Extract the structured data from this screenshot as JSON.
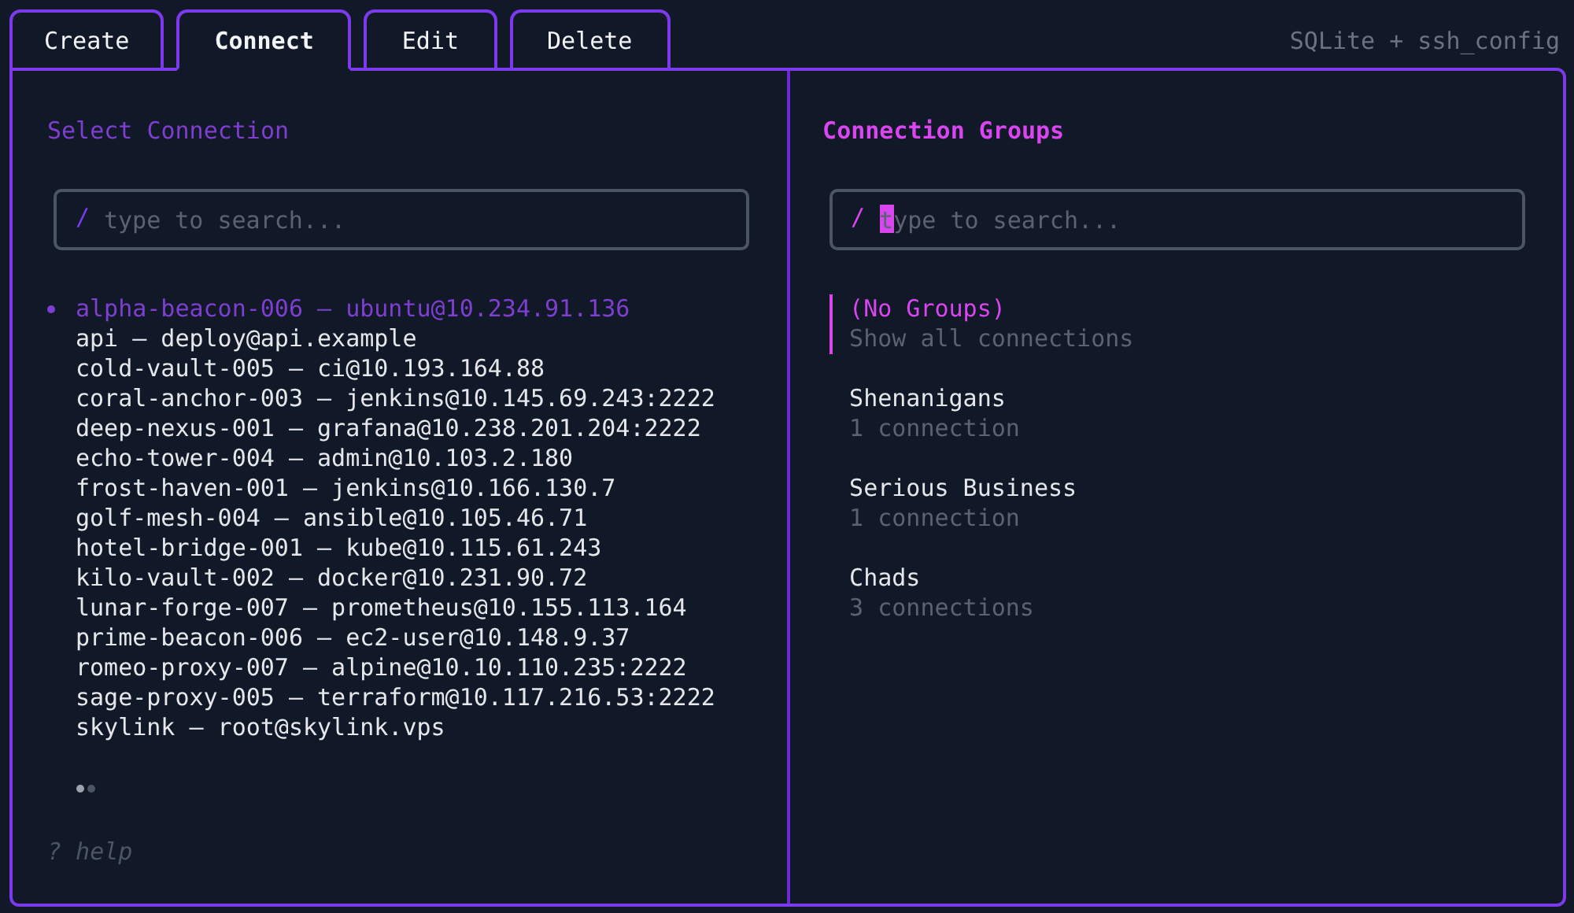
{
  "tabs": [
    {
      "label": "Create",
      "selected": false
    },
    {
      "label": "Connect",
      "selected": true
    },
    {
      "label": "Edit",
      "selected": false
    },
    {
      "label": "Delete",
      "selected": false
    }
  ],
  "source_label": "SQLite + ssh_config",
  "connections_panel": {
    "title": "Select Connection",
    "search": {
      "prefix": "/",
      "placeholder": "type to search...",
      "focused": false
    },
    "items": [
      {
        "name": "alpha-beacon-006",
        "separator": "–",
        "target": "ubuntu@10.234.91.136",
        "selected": true
      },
      {
        "name": "api",
        "separator": "–",
        "target": "deploy@api.example",
        "selected": false
      },
      {
        "name": "cold-vault-005",
        "separator": "–",
        "target": "ci@10.193.164.88",
        "selected": false
      },
      {
        "name": "coral-anchor-003",
        "separator": "–",
        "target": "jenkins@10.145.69.243:2222",
        "selected": false
      },
      {
        "name": "deep-nexus-001",
        "separator": "–",
        "target": "grafana@10.238.201.204:2222",
        "selected": false
      },
      {
        "name": "echo-tower-004",
        "separator": "–",
        "target": "admin@10.103.2.180",
        "selected": false
      },
      {
        "name": "frost-haven-001",
        "separator": "–",
        "target": "jenkins@10.166.130.7",
        "selected": false
      },
      {
        "name": "golf-mesh-004",
        "separator": "–",
        "target": "ansible@10.105.46.71",
        "selected": false
      },
      {
        "name": "hotel-bridge-001",
        "separator": "–",
        "target": "kube@10.115.61.243",
        "selected": false
      },
      {
        "name": "kilo-vault-002",
        "separator": "–",
        "target": "docker@10.231.90.72",
        "selected": false
      },
      {
        "name": "lunar-forge-007",
        "separator": "–",
        "target": "prometheus@10.155.113.164",
        "selected": false
      },
      {
        "name": "prime-beacon-006",
        "separator": "–",
        "target": "ec2-user@10.148.9.37",
        "selected": false
      },
      {
        "name": "romeo-proxy-007",
        "separator": "–",
        "target": "alpine@10.10.110.235:2222",
        "selected": false
      },
      {
        "name": "sage-proxy-005",
        "separator": "–",
        "target": "terraform@10.117.216.53:2222",
        "selected": false
      },
      {
        "name": "skylink",
        "separator": "–",
        "target": "root@skylink.vps",
        "selected": false
      }
    ],
    "help": "? help"
  },
  "groups_panel": {
    "title": "Connection Groups",
    "search": {
      "prefix": "/",
      "placeholder": "type to search...",
      "focused": true
    },
    "items": [
      {
        "name": "(No Groups)",
        "description": "Show all connections",
        "selected": true
      },
      {
        "name": "Shenanigans",
        "description": "1 connection",
        "selected": false
      },
      {
        "name": "Serious Business",
        "description": "1 connection",
        "selected": false
      },
      {
        "name": "Chads",
        "description": "3 connections",
        "selected": false
      }
    ]
  }
}
